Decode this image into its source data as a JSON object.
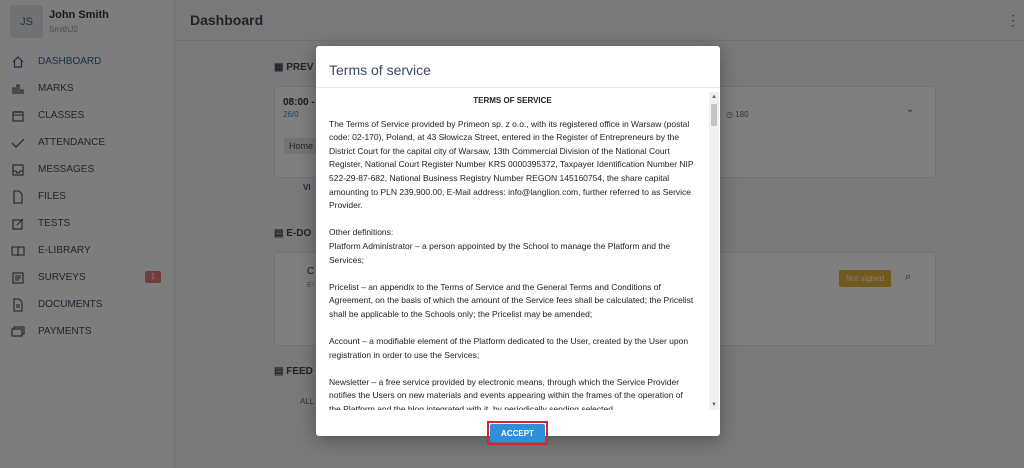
{
  "user": {
    "initials": "JS",
    "name": "John Smith",
    "login": "SmithJ2"
  },
  "header": {
    "title": "Dashboard",
    "menu_glyph": "⋮"
  },
  "sidebar": {
    "items": [
      {
        "label": "DASHBOARD",
        "icon": "home-icon"
      },
      {
        "label": "MARKS",
        "icon": "bar-chart-icon"
      },
      {
        "label": "CLASSES",
        "icon": "calendar-icon"
      },
      {
        "label": "ATTENDANCE",
        "icon": "check-icon"
      },
      {
        "label": "MESSAGES",
        "icon": "inbox-icon"
      },
      {
        "label": "FILES",
        "icon": "file-icon"
      },
      {
        "label": "TESTS",
        "icon": "edit-icon"
      },
      {
        "label": "E-LIBRARY",
        "icon": "book-icon"
      },
      {
        "label": "SURVEYS",
        "icon": "survey-icon",
        "badge": "1"
      },
      {
        "label": "DOCUMENTS",
        "icon": "document-icon"
      },
      {
        "label": "PAYMENTS",
        "icon": "wallet-icon"
      }
    ]
  },
  "background": {
    "prev_heading": "PREV",
    "time": "08:00 -",
    "date": "26/0",
    "duration": "180",
    "home_chip": "Home",
    "view_link": "VI",
    "edoc_heading": "E-DO",
    "doc_initial": "C",
    "doc_sub": "E-",
    "not_signed": "Not signed",
    "feed_heading": "FEED",
    "feed_tab": "ALL"
  },
  "modal": {
    "title": "Terms of service",
    "heading": "TERMS OF SERVICE",
    "paragraphs": [
      "The Terms of Service provided by Primeon sp. z o.o., with its registered office in Warsaw (postal code: 02-170), Poland, at 43 Słowicza Street, entered in the Register of Entrepreneurs by the District Court for the capital city of Warsaw, 13th Commercial Division of the National Court Register, National Court Register Number KRS 0000395372, Taxpayer Identification Number NIP 522-29-87-682, National Business Registry Number REGON 145160754, the share capital amounting to PLN 239,900.00, E-Mail address: info@langlion.com, further referred to as Service Provider.",
      "Other definitions:\nPlatform Administrator – a person appointed by the School to manage the Platform and the Services;",
      "Pricelist – an appendix to the Terms of Service and the General Terms and Conditions of Agreement, on the basis of which the amount of the Service fees shall be calculated; the Pricelist shall be applicable to the Schools only; the Pricelist may be amended;",
      "Account – a modifiable element of the Platform dedicated to the User, created by the User upon registration in order to use the Services;",
      "Newsletter – a free service provided by electronic means, through which the Service Provider notifies the Users on new materials and events appearing within the frames of the operation of the Platform and the blog integrated with it, by periodically sending selected"
    ],
    "accept_label": "ACCEPT"
  },
  "colors": {
    "accent": "#2f8fd8",
    "highlight": "#d9232d",
    "badge": "#e07a7a",
    "warning": "#e6b33a"
  }
}
